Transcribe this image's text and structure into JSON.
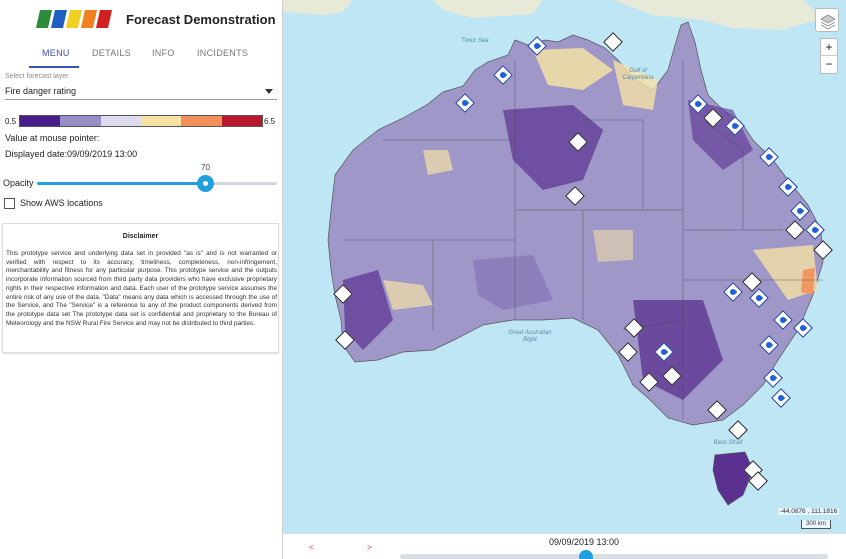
{
  "app": {
    "title": "Forecast Demonstration",
    "logo_colors": [
      "#2e8b3d",
      "#1f5fbf",
      "#f0d020",
      "#f08020",
      "#d02020"
    ]
  },
  "tabs": [
    "MENU",
    "DETAILS",
    "INFO",
    "INCIDENTS"
  ],
  "active_tab": "MENU",
  "layer_select": {
    "label": "Select forecast layer",
    "value": "Fire danger rating"
  },
  "legend": {
    "min": "0.5",
    "max": "6.5",
    "colors": [
      "#4a1e8a",
      "#9590c8",
      "#dcdcec",
      "#f7e2a6",
      "#f2905c",
      "#b8182e"
    ]
  },
  "value_at_pointer_label": "Value at mouse pointer:",
  "displayed_date_label": "Displayed date:09/09/2019 13:00",
  "opacity": {
    "label": "Opacity",
    "value": "70",
    "fraction": 0.7
  },
  "aws_checkbox": {
    "label": "Show AWS locations",
    "checked": false
  },
  "disclaimer": {
    "title": "Disclaimer",
    "text": "This prototype service and underlying data set in provided \"as is\" and is not warranted or verified with respect to its accuracy, timeliness, completeness, non-infringement, merchantability and fitness for any particular purpose. This prototype service and the outputs incorporate information sourced from third party data providers who have exclusive proprietary rights in their respective information and data. Each user of the prototype service assumes the entire risk of any use of the data. \"Data\" means any data which is accessed through the use of the Service, and The \"Service\" is a reference to any of the product components derived from the prototype data set The prototype data set is confidential and proprietary to the Bureau of Meteorology and the NSW Rural Fire Service and may not be distributed to third parties."
  },
  "map": {
    "labels": [
      "Timor Sea",
      "Gulf of Carpentaria",
      "Great Australian Bight",
      "Bass Strait"
    ],
    "coordinates": "-44.0876 , 111.1816",
    "scale_label": "300 km",
    "zoom_in": "+",
    "zoom_out": "−"
  },
  "timebar": {
    "label": "09/09/2019 13:00",
    "prev": "<",
    "next": ">",
    "position": 0.7
  }
}
